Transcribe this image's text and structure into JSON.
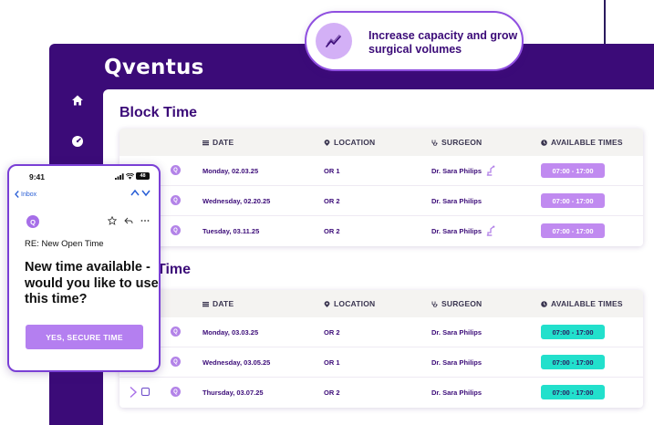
{
  "app": {
    "brand": "Qventus"
  },
  "banner": {
    "text": "Increase capacity and grow surgical volumes",
    "icon": "trend-up-icon"
  },
  "nav": {
    "icons": [
      "home-icon",
      "gauge-icon"
    ]
  },
  "columns": {
    "date": "DATE",
    "location": "LOCATION",
    "surgeon": "SURGEON",
    "available": "AVAILABLE TIMES"
  },
  "block_time": {
    "title": "Block Time",
    "rows": [
      {
        "badge": "Q",
        "date": "Monday, 02.03.25",
        "location": "OR 1",
        "surgeon": "Dr. Sara Philips",
        "robot": true,
        "time": "07:00 - 17:00"
      },
      {
        "badge": "Q",
        "date": "Wednesday, 02.20.25",
        "location": "OR 2",
        "surgeon": "Dr. Sara Philips",
        "robot": false,
        "time": "07:00 - 17:00"
      },
      {
        "badge": "Q",
        "date": "Tuesday, 03.11.25",
        "location": "OR 2",
        "surgeon": "Dr. Sara Philips",
        "robot": true,
        "time": "07:00 - 17:00"
      }
    ]
  },
  "open_time": {
    "title": "Time",
    "rows": [
      {
        "badge": "Q",
        "date": "Monday, 03.03.25",
        "location": "OR 2",
        "surgeon": "Dr. Sara Philips",
        "time": "07:00 - 17:00"
      },
      {
        "badge": "Q",
        "date": "Wednesday, 03.05.25",
        "location": "OR 1",
        "surgeon": "Dr. Sara Philips",
        "time": "07:00 - 17:00"
      },
      {
        "badge": "Q",
        "date": "Thursday, 03.07.25",
        "location": "OR 2",
        "surgeon": "Dr. Sara Philips",
        "time": "07:00 - 17:00"
      }
    ]
  },
  "phone": {
    "time": "9:41",
    "battery": "48",
    "back_label": "Inbox",
    "sender_initial": "Q",
    "subject": "RE: New Open Time",
    "message": "New time available - would you like to use this time?",
    "button": "YES, SECURE TIME"
  },
  "colors": {
    "brand_purple": "#3b0b78",
    "pill_purple": "#c08af0",
    "pill_teal": "#22e0cc",
    "accent": "#8f4fe0"
  }
}
